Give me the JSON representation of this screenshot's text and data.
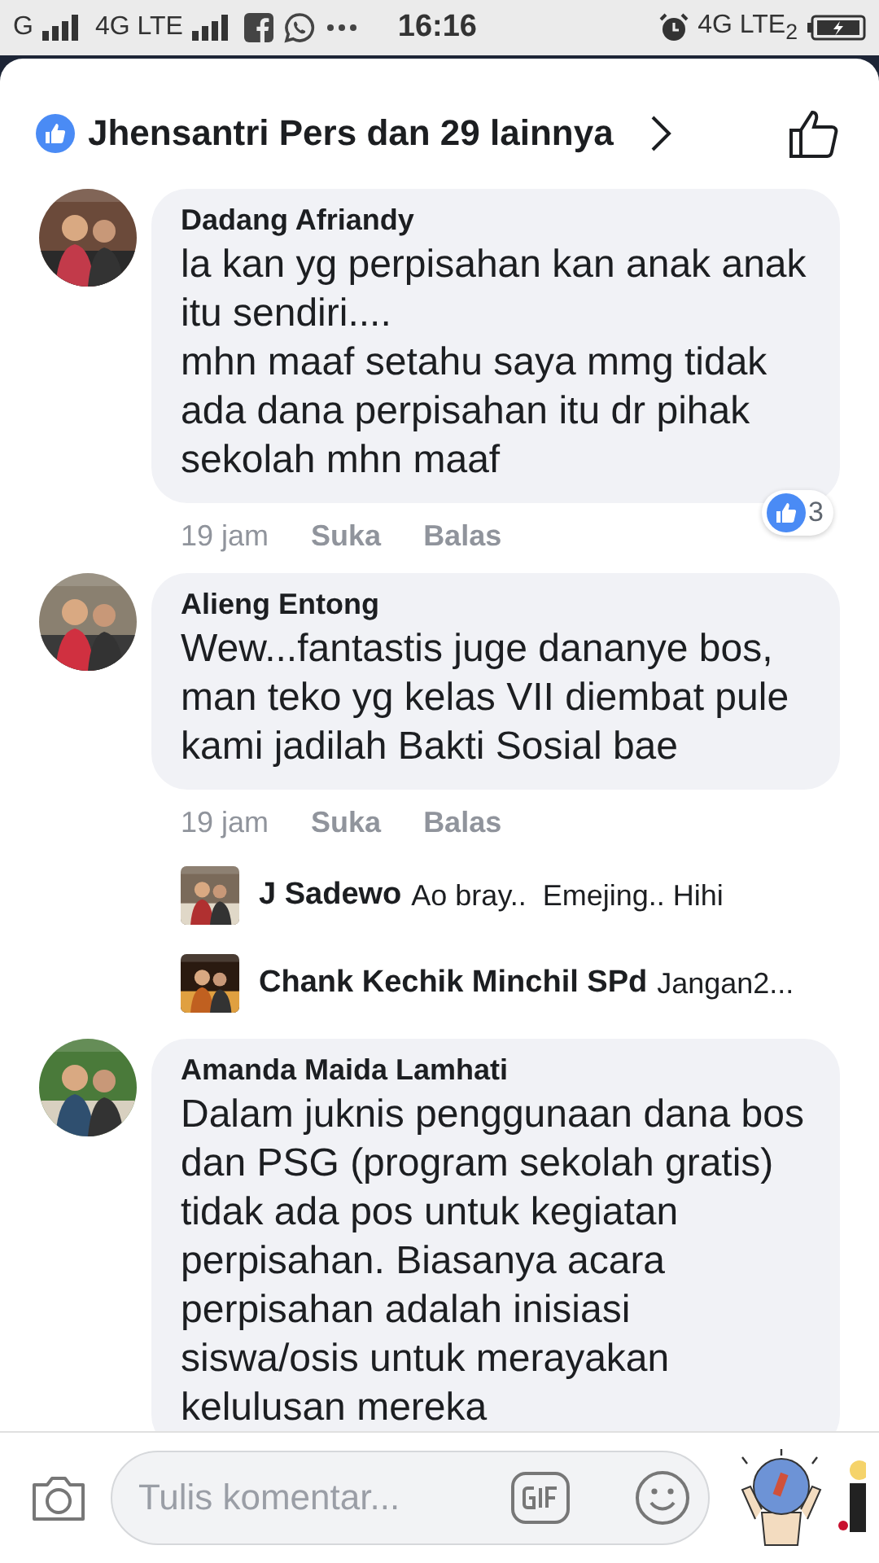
{
  "status_bar": {
    "signal_1": "G",
    "network_1": "4G LTE",
    "time": "16:16",
    "network_2": "4G LTE$_{2}$"
  },
  "reactions": {
    "text": "Jhensantri Pers dan 29 lainnya"
  },
  "comments": [
    {
      "author": "Dadang Afriandy",
      "text": "la kan yg perpisahan kan anak anak itu sendiri....\nmhn maaf setahu saya mmg tidak ada dana perpisahan itu dr pihak sekolah mhn maaf",
      "time": "19 jam",
      "like": "Suka",
      "reply": "Balas",
      "reaction_count": "3"
    },
    {
      "author": "Alieng Entong",
      "text": "Wew...fantastis juge dananye bos, man teko yg kelas VII diembat pule kami jadilah Bakti Sosial bae",
      "time": "19 jam",
      "like": "Suka",
      "reply": "Balas",
      "replies": [
        {
          "author": "J Sadewo",
          "text": "Ao bray..  Emejing.. Hihi"
        },
        {
          "author": "Chank Kechik Minchil SPd",
          "text": "Jangan2..."
        }
      ]
    },
    {
      "author": "Amanda Maida Lamhati",
      "text": "Dalam juknis penggunaan dana bos dan PSG (program sekolah gratis) tidak ada pos untuk kegiatan perpisahan. Biasanya acara perpisahan adalah inisiasi siswa/osis untuk merayakan kelulusan mereka"
    }
  ],
  "composer": {
    "placeholder": "Tulis komentar..."
  }
}
